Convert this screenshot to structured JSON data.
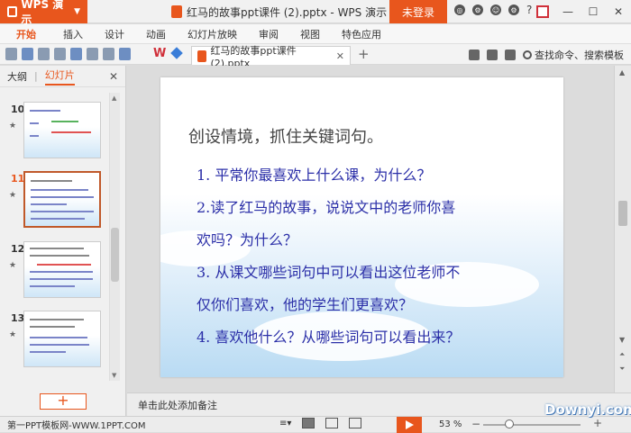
{
  "app": {
    "name": "WPS 演示",
    "window_title": "红马的故事ppt课件 (2).pptx - WPS 演示",
    "login_label": "未登录"
  },
  "menu": {
    "tabs": [
      "开始",
      "插入",
      "设计",
      "动画",
      "幻灯片放映",
      "审阅",
      "视图",
      "特色应用"
    ]
  },
  "toolbar": {
    "doc_tab": "红马的故事ppt课件 (2).pptx",
    "search_command": "查找命令、搜索模板"
  },
  "left_panel": {
    "tab_outline": "大纲",
    "tab_slides": "幻灯片",
    "slides": [
      {
        "num": "10",
        "selected": false
      },
      {
        "num": "11",
        "selected": true
      },
      {
        "num": "12",
        "selected": false
      },
      {
        "num": "13",
        "selected": false
      }
    ],
    "star": "★",
    "add_slide": "+"
  },
  "slide": {
    "title": "创设情境，抓住关键词句。",
    "lines": [
      "1.  平常你最喜欢上什么课，为什么？",
      "2.读了红马的故事，说说文中的老师你喜",
      "欢吗？为什么？",
      "3.  从课文哪些词句中可以看出这位老师不",
      "仅你们喜欢，他的学生们更喜欢？",
      "4.  喜欢他什么？从哪些词句可以看出来？"
    ]
  },
  "notes_placeholder": "单击此处添加备注",
  "status": {
    "site": "第一PPT模板网-WWW.1PPT.COM",
    "zoom": "53 %",
    "zoom_level": 0.53
  },
  "watermark": "Downyi.com",
  "colors": {
    "accent": "#e8561d",
    "slide_body": "#2b2fa8"
  }
}
